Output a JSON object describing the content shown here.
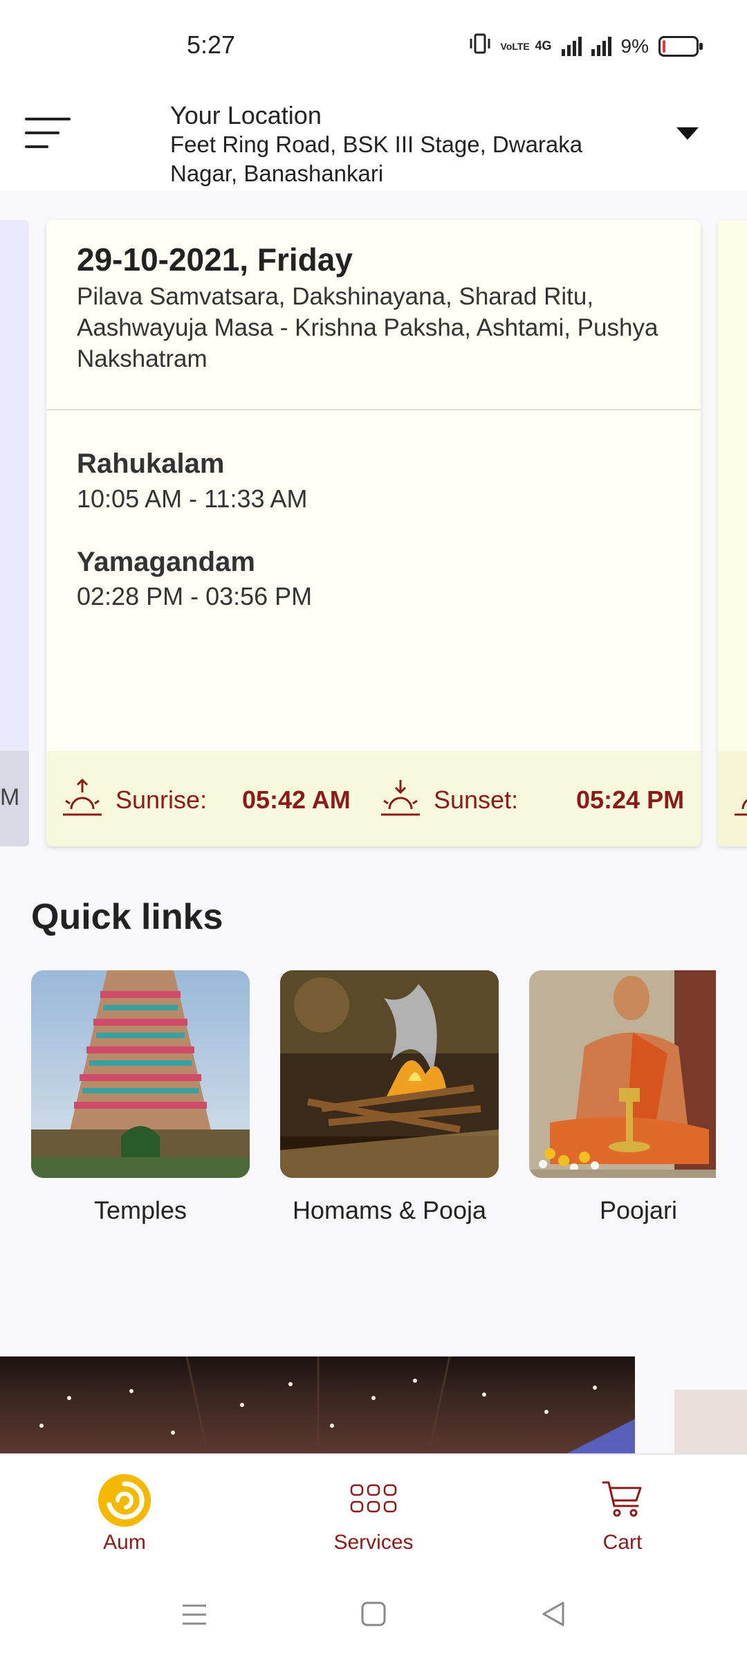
{
  "status_bar": {
    "time": "5:27",
    "network_label": "4G",
    "volte_label": "VoLTE",
    "battery_percent": "9%",
    "battery_level": 0.09
  },
  "header": {
    "location_title": "Your Location",
    "location_address": "Feet Ring Road, BSK III Stage, Dwaraka Nagar, Banashankari"
  },
  "calendar": {
    "date": "29-10-2021, Friday",
    "panchang": "Pilava Samvatsara, Dakshinayana, Sharad Ritu, Aashwayuja Masa - Krishna Paksha, Ashtami, Pushya Nakshatram",
    "rahukalam_label": "Rahukalam",
    "rahukalam_time": "10:05 AM - 11:33 AM",
    "yamagandam_label": "Yamagandam",
    "yamagandam_time": "02:28 PM - 03:56 PM",
    "sunrise_label": "Sunrise:",
    "sunrise_time": "05:42 AM",
    "sunset_label": "Sunset:",
    "sunset_time": "05:24 PM",
    "prev_card_peek_text": "M"
  },
  "quick_links": {
    "title": "Quick links",
    "items": [
      {
        "label": "Temples"
      },
      {
        "label": "Homams & Pooja"
      },
      {
        "label": "Poojari"
      }
    ]
  },
  "bottom_nav": {
    "items": [
      {
        "label": "Aum",
        "icon": "aum-logo-icon"
      },
      {
        "label": "Services",
        "icon": "services-grid-icon"
      },
      {
        "label": "Cart",
        "icon": "cart-icon"
      }
    ]
  },
  "colors": {
    "accent": "#8b1a1a",
    "card_bg": "#fefef4",
    "card_footer": "#f8f8dc",
    "logo_gold": "#f5b800"
  }
}
